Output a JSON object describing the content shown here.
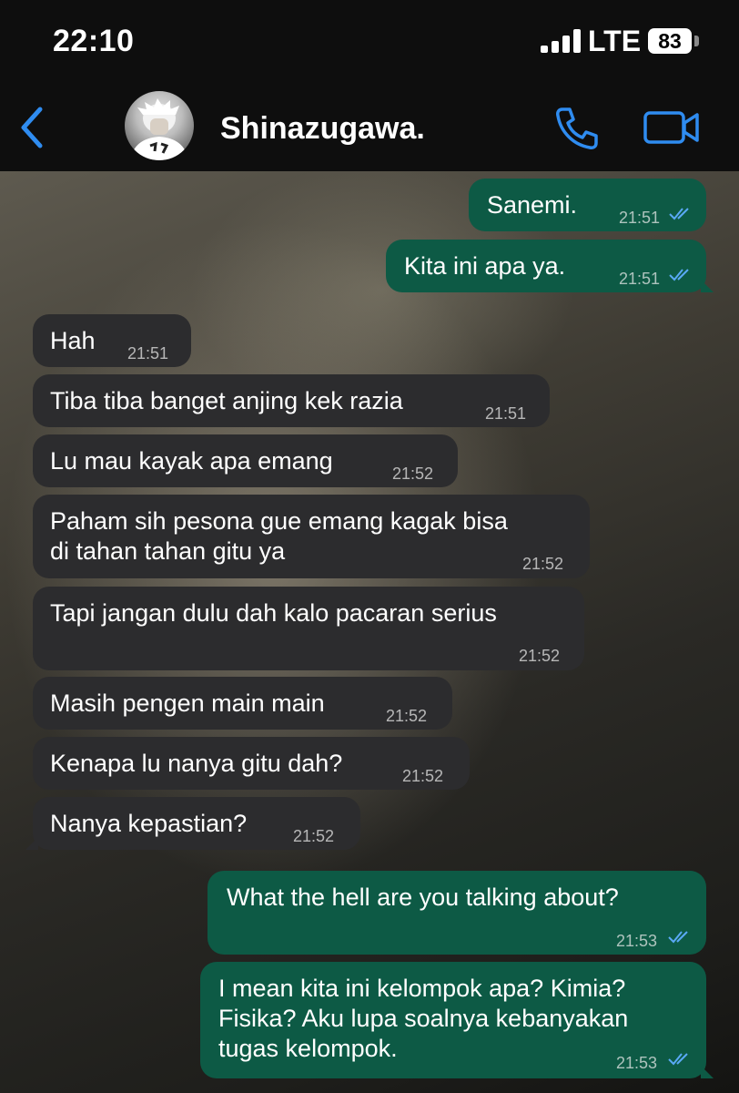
{
  "status_bar": {
    "time": "22:10",
    "network": "LTE",
    "battery": "83"
  },
  "header": {
    "contact_name": "Shinazugawa."
  },
  "messages": [
    {
      "dir": "out",
      "text": "Sanemi.",
      "time": "21:51"
    },
    {
      "dir": "out",
      "text": "Kita ini apa ya.",
      "time": "21:51"
    },
    {
      "dir": "in",
      "text": "Hah",
      "time": "21:51"
    },
    {
      "dir": "in",
      "text": "Tiba tiba banget anjing kek razia",
      "time": "21:51"
    },
    {
      "dir": "in",
      "text": "Lu mau kayak apa emang",
      "time": "21:52"
    },
    {
      "dir": "in",
      "lines": [
        "Paham sih pesona gue emang kagak bisa",
        "di tahan tahan gitu ya"
      ],
      "time": "21:52"
    },
    {
      "dir": "in",
      "text": "Tapi jangan dulu dah kalo pacaran serius",
      "time": "21:52"
    },
    {
      "dir": "in",
      "text": "Masih pengen main main",
      "time": "21:52"
    },
    {
      "dir": "in",
      "text": "Kenapa lu nanya gitu dah?",
      "time": "21:52"
    },
    {
      "dir": "in",
      "text": "Nanya kepastian?",
      "time": "21:52"
    },
    {
      "dir": "out",
      "text": "What the hell are you talking about?",
      "time": "21:53"
    },
    {
      "dir": "out",
      "lines": [
        "I mean kita ini kelompok apa? Kimia?",
        "Fisika? Aku lupa soalnya kebanyakan",
        "tugas kelompok."
      ],
      "time": "21:53"
    }
  ],
  "colors": {
    "incoming_bubble": "#2c2c2e",
    "outgoing_bubble": "#0d5a45",
    "accent": "#2f8cf0",
    "read_check": "#5aa9f5"
  },
  "icons": [
    "back-chevron-icon",
    "phone-icon",
    "video-camera-icon",
    "double-check-icon"
  ]
}
